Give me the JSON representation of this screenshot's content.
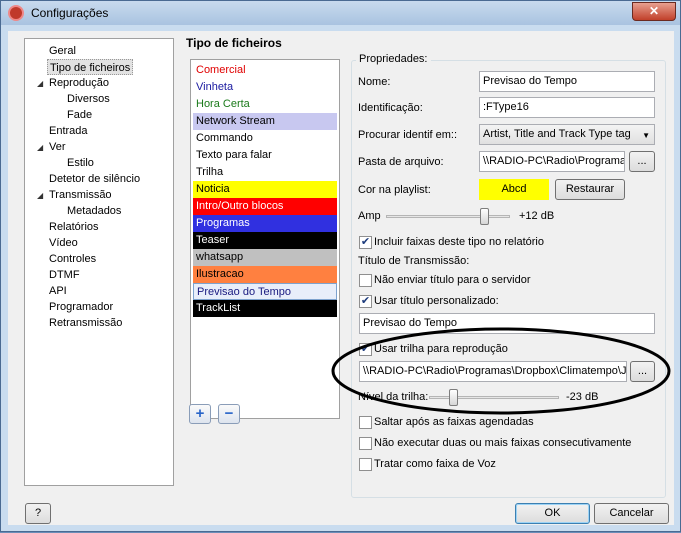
{
  "window": {
    "title": "Configurações",
    "close": "✕"
  },
  "tree": {
    "items": [
      {
        "label": "Geral",
        "expander": ""
      },
      {
        "label": "Tipo de ficheiros",
        "expander": "",
        "selected": true
      },
      {
        "label": "Reprodução",
        "expander": "◢"
      },
      {
        "label": "Diversos",
        "expander": ""
      },
      {
        "label": "Fade",
        "expander": ""
      },
      {
        "label": "Entrada",
        "expander": ""
      },
      {
        "label": "Ver",
        "expander": "◢"
      },
      {
        "label": "Estilo",
        "expander": ""
      },
      {
        "label": "Detetor de silêncio",
        "expander": ""
      },
      {
        "label": "Transmissão",
        "expander": "◢"
      },
      {
        "label": "Metadados",
        "expander": ""
      },
      {
        "label": "Relatórios",
        "expander": ""
      },
      {
        "label": "Vídeo",
        "expander": ""
      },
      {
        "label": "Controles",
        "expander": ""
      },
      {
        "label": "DTMF",
        "expander": ""
      },
      {
        "label": "API",
        "expander": ""
      },
      {
        "label": "Programador",
        "expander": ""
      },
      {
        "label": "Retransmissão",
        "expander": ""
      }
    ]
  },
  "section_title": "Tipo de ficheiros",
  "types": [
    {
      "label": "Comercial",
      "color": "#e00000",
      "bg": "#ffffff"
    },
    {
      "label": "Vinheta",
      "color": "#1a1aa0",
      "bg": "#ffffff"
    },
    {
      "label": "Hora Certa",
      "color": "#1a7a1a",
      "bg": "#ffffff"
    },
    {
      "label": "Network Stream",
      "color": "#000000",
      "bg": "#c8c8f0"
    },
    {
      "label": "Commando",
      "color": "#000000",
      "bg": "#ffffff"
    },
    {
      "label": "Texto para falar",
      "color": "#000000",
      "bg": "#ffffff"
    },
    {
      "label": "Trilha",
      "color": "#000000",
      "bg": "#ffffff"
    },
    {
      "label": "Noticia",
      "color": "#000000",
      "bg": "#ffff00"
    },
    {
      "label": "Intro/Outro blocos",
      "color": "#ffffff",
      "bg": "#ff0000"
    },
    {
      "label": "Programas",
      "color": "#ffffff",
      "bg": "#3030e0"
    },
    {
      "label": "Teaser",
      "color": "#ffffff",
      "bg": "#000000"
    },
    {
      "label": "whatsapp",
      "color": "#000000",
      "bg": "#c0c0c0"
    },
    {
      "label": "Ilustracao",
      "color": "#000000",
      "bg": "#ff8040"
    },
    {
      "label": "Previsao do Tempo",
      "color": "#1a1a80",
      "bg": "#e8eefa"
    },
    {
      "label": "TrackList",
      "color": "#ffffff",
      "bg": "#000000"
    }
  ],
  "list_buttons": {
    "add": "+",
    "remove": "−"
  },
  "props": {
    "group_title": "Propriedades:",
    "name_label": "Nome:",
    "name_value": "Previsao do Tempo",
    "id_label": "Identificação:",
    "id_value": ":FType16",
    "search_label": "Procurar identif em::",
    "search_value": "Artist, Title and Track Type tag",
    "folder_label": "Pasta de arquivo:",
    "folder_value": "\\\\RADIO-PC\\Radio\\Programas",
    "browse": "...",
    "color_label": "Cor na playlist:",
    "color_sample": "Abcd",
    "color_sample_bg": "#ffff00",
    "restore": "Restaurar",
    "amp_label": "Amp",
    "amp_value": "+12 dB",
    "include_report": "Incluir faixas deste tipo no relatório",
    "transmission_title": "Título de Transmissão:",
    "no_send_title": "Não enviar título para o servidor",
    "custom_title": "Usar título personalizado:",
    "custom_title_value": "Previsao do Tempo",
    "use_track": "Usar trilha para reprodução",
    "track_path": "\\\\RADIO-PC\\Radio\\Programas\\Dropbox\\Climatempo\\Jo",
    "track_level_label": "Nível da trilha:",
    "track_level_value": "-23 dB",
    "skip_scheduled": "Saltar após as faixas agendadas",
    "no_consecutive": "Não executar duas ou mais faixas consecutivamente",
    "treat_voice": "Tratar como faixa de Voz"
  },
  "footer": {
    "help": "?",
    "ok": "OK",
    "cancel": "Cancelar"
  }
}
